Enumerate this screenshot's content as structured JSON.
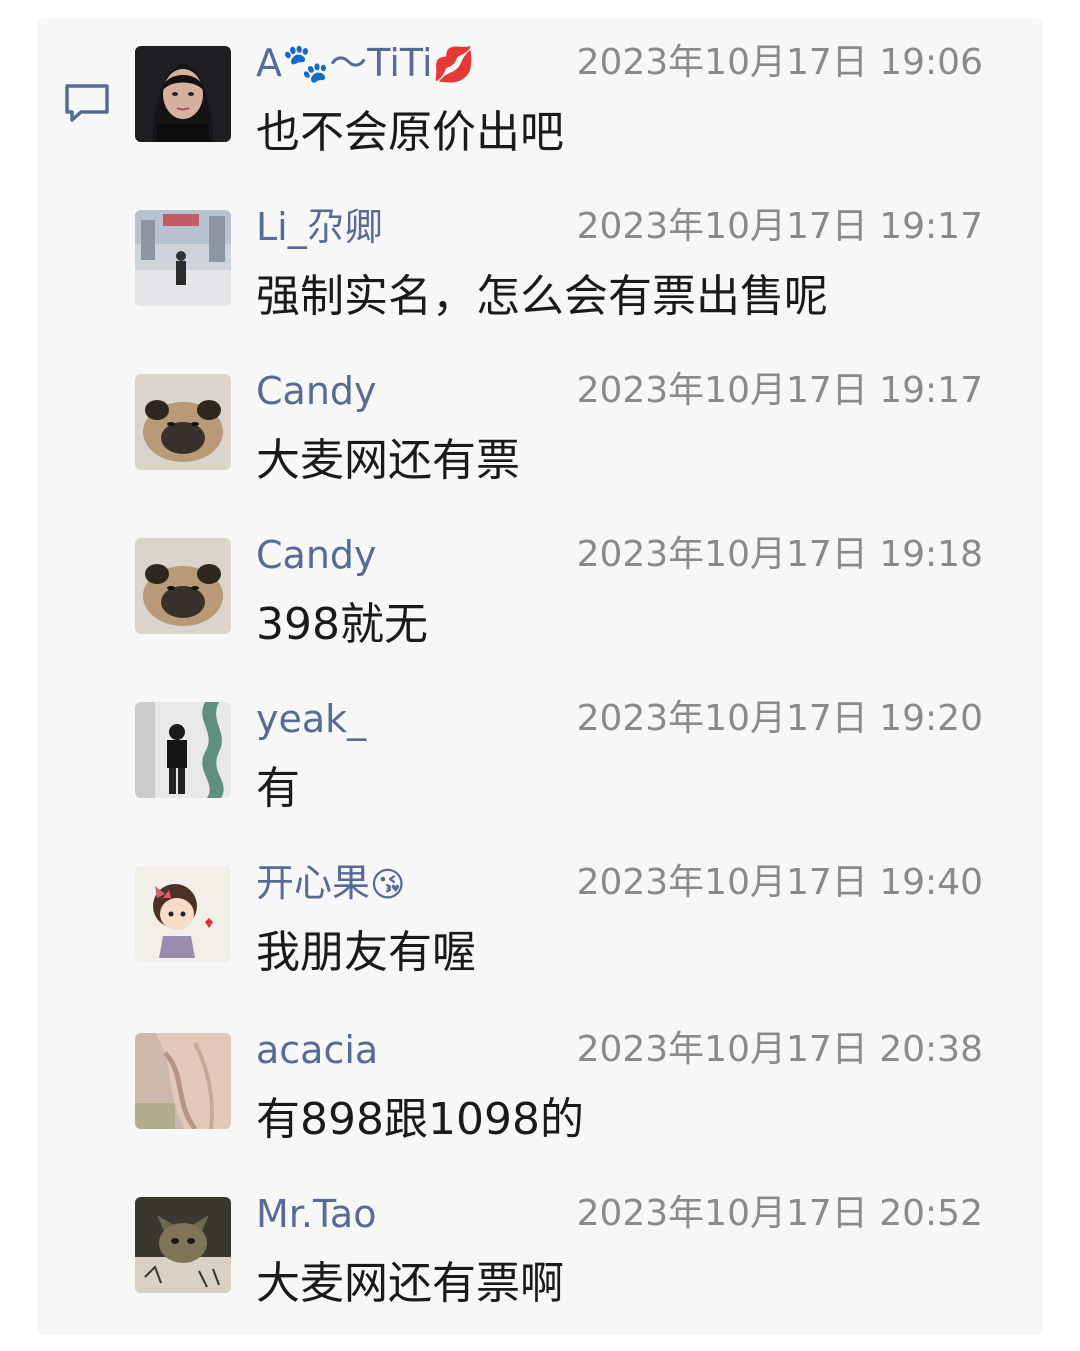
{
  "comments": [
    {
      "name": "A🐾～TiTi",
      "name_emoji": "💋",
      "time": "2023年10月17日 19:06",
      "message": "也不会原价出吧",
      "avatar": "woman-photo-avatar"
    },
    {
      "name": "Li_尕卿",
      "name_emoji": "",
      "time": "2023年10月17日 19:17",
      "message": "强制实名，怎么会有票出售呢",
      "avatar": "street-photo-avatar"
    },
    {
      "name": "Candy",
      "name_emoji": "",
      "time": "2023年10月17日 19:17",
      "message": "大麦网还有票",
      "avatar": "pug-avatar"
    },
    {
      "name": "Candy",
      "name_emoji": "",
      "time": "2023年10月17日 19:18",
      "message": "398就无",
      "avatar": "pug-avatar"
    },
    {
      "name": "yeak_",
      "name_emoji": "",
      "time": "2023年10月17日 19:20",
      "message": "有",
      "avatar": "mirror-selfie-avatar"
    },
    {
      "name": "开心果",
      "name_emoji": "😘",
      "time": "2023年10月17日 19:40",
      "message": "我朋友有喔",
      "avatar": "cartoon-girl-avatar"
    },
    {
      "name": "acacia",
      "name_emoji": "",
      "time": "2023年10月17日 20:38",
      "message": "有898跟1098的",
      "avatar": "dress-photo-avatar"
    },
    {
      "name": "Mr.Tao",
      "name_emoji": "",
      "time": "2023年10月17日 20:52",
      "message": "大麦网还有票啊",
      "avatar": "cat-avatar"
    }
  ],
  "icons": {
    "comment": "comment-bubble-icon"
  },
  "colors": {
    "name": "#576b95",
    "time": "#8a8a8a",
    "text": "#1a1a1a",
    "panel": "#f7f7f7"
  }
}
